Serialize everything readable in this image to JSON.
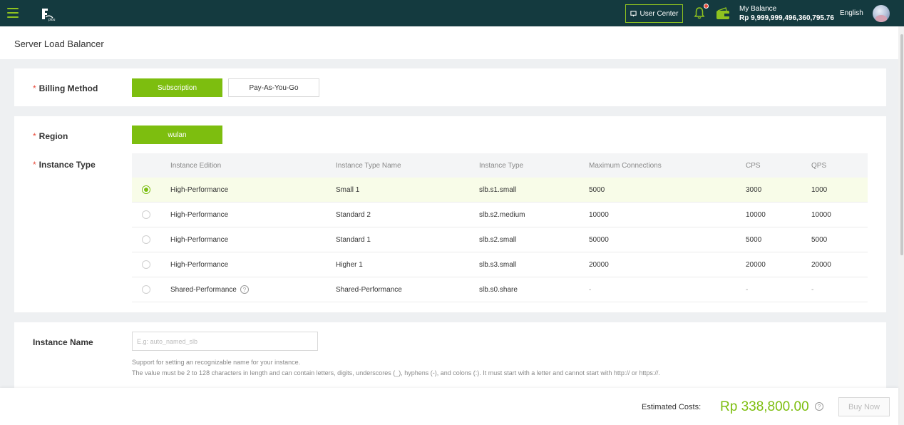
{
  "topbar": {
    "user_center_label": "User Center",
    "balance_label": "My Balance",
    "balance_value": "Rp 9,999,999,496,360,795.76",
    "language": "English",
    "accent_color": "#8fc31f",
    "bar_color": "#143a3f"
  },
  "page": {
    "title": "Server Load Balancer"
  },
  "billing": {
    "label": "Billing Method",
    "options": [
      "Subscription",
      "Pay-As-You-Go"
    ],
    "selected": "Subscription"
  },
  "region": {
    "label": "Region",
    "value": "wulan"
  },
  "instance_type": {
    "label": "Instance Type",
    "columns": [
      "Instance Edition",
      "Instance Type Name",
      "Instance Type",
      "Maximum Connections",
      "CPS",
      "QPS"
    ],
    "rows": [
      {
        "edition": "High-Performance",
        "type_name": "Small 1",
        "type": "slb.s1.small",
        "max_conn": "5000",
        "cps": "3000",
        "qps": "1000",
        "selected": true
      },
      {
        "edition": "High-Performance",
        "type_name": "Standard 2",
        "type": "slb.s2.medium",
        "max_conn": "10000",
        "cps": "10000",
        "qps": "10000",
        "selected": false
      },
      {
        "edition": "High-Performance",
        "type_name": "Standard 1",
        "type": "slb.s2.small",
        "max_conn": "50000",
        "cps": "5000",
        "qps": "5000",
        "selected": false
      },
      {
        "edition": "High-Performance",
        "type_name": "Higher 1",
        "type": "slb.s3.small",
        "max_conn": "20000",
        "cps": "20000",
        "qps": "20000",
        "selected": false
      },
      {
        "edition": "Shared-Performance",
        "type_name": "Shared-Performance",
        "type": "slb.s0.share",
        "max_conn": "-",
        "cps": "-",
        "qps": "-",
        "selected": false
      }
    ]
  },
  "instance_name": {
    "label": "Instance Name",
    "placeholder": "E.g: auto_named_slb",
    "value": "",
    "help_1": "Support for setting an recognizable name for your instance.",
    "help_2": "The value must be 2 to 128 characters in length and can contain letters, digits, underscores (_), hyphens (-), and colons (:). It must start with a letter and cannot start with http:// or https://."
  },
  "footer": {
    "estimated_label": "Estimated Costs:",
    "estimated_value": "Rp 338,800.00",
    "buy_label": "Buy Now",
    "price_color": "#7dbe0f"
  }
}
